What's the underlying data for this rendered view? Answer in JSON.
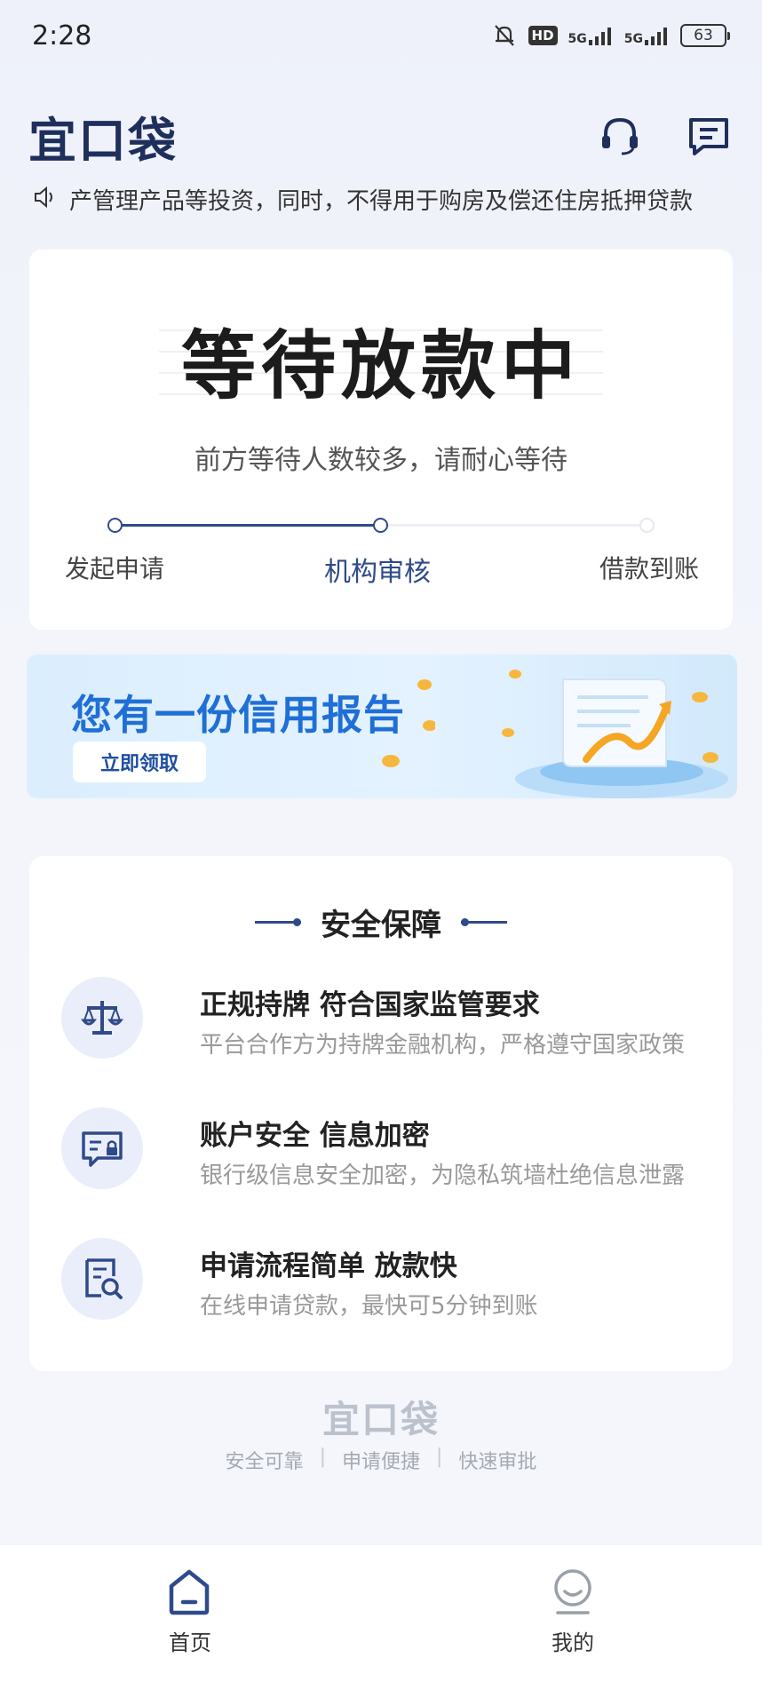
{
  "status_bar": {
    "time": "2:28",
    "hd": "HD",
    "net1": "5G",
    "net2": "5G",
    "battery": "63"
  },
  "header": {
    "logo": "宜口袋"
  },
  "notice": {
    "text": "产管理产品等投资，同时，不得用于购房及偿还住房抵押贷款"
  },
  "status_card": {
    "title": "等待放款中",
    "subtitle": "前方等待人数较多，请耐心等待",
    "steps": [
      "发起申请",
      "机构审核",
      "借款到账"
    ],
    "active_step": 1
  },
  "banner": {
    "title": "您有一份信用报告",
    "button": "立即领取"
  },
  "safety": {
    "title": "安全保障",
    "features": [
      {
        "title": "正规持牌 符合国家监管要求",
        "desc": "平台合作方为持牌金融机构，严格遵守国家政策",
        "icon": "scale-icon"
      },
      {
        "title": "账户安全 信息加密",
        "desc": "银行级信息安全加密，为隐私筑墙杜绝信息泄露",
        "icon": "secure-id-icon"
      },
      {
        "title": "申请流程简单 放款快",
        "desc": "在线申请贷款，最快可5分钟到账",
        "icon": "document-search-icon"
      }
    ]
  },
  "footer": {
    "brand": "宜口袋",
    "tags": [
      "安全可靠",
      "申请便捷",
      "快速审批"
    ]
  },
  "tabbar": {
    "home": "首页",
    "mine": "我的"
  },
  "colors": {
    "accent": "#2f4a8a",
    "banner_blue": "#1f6fd6"
  }
}
